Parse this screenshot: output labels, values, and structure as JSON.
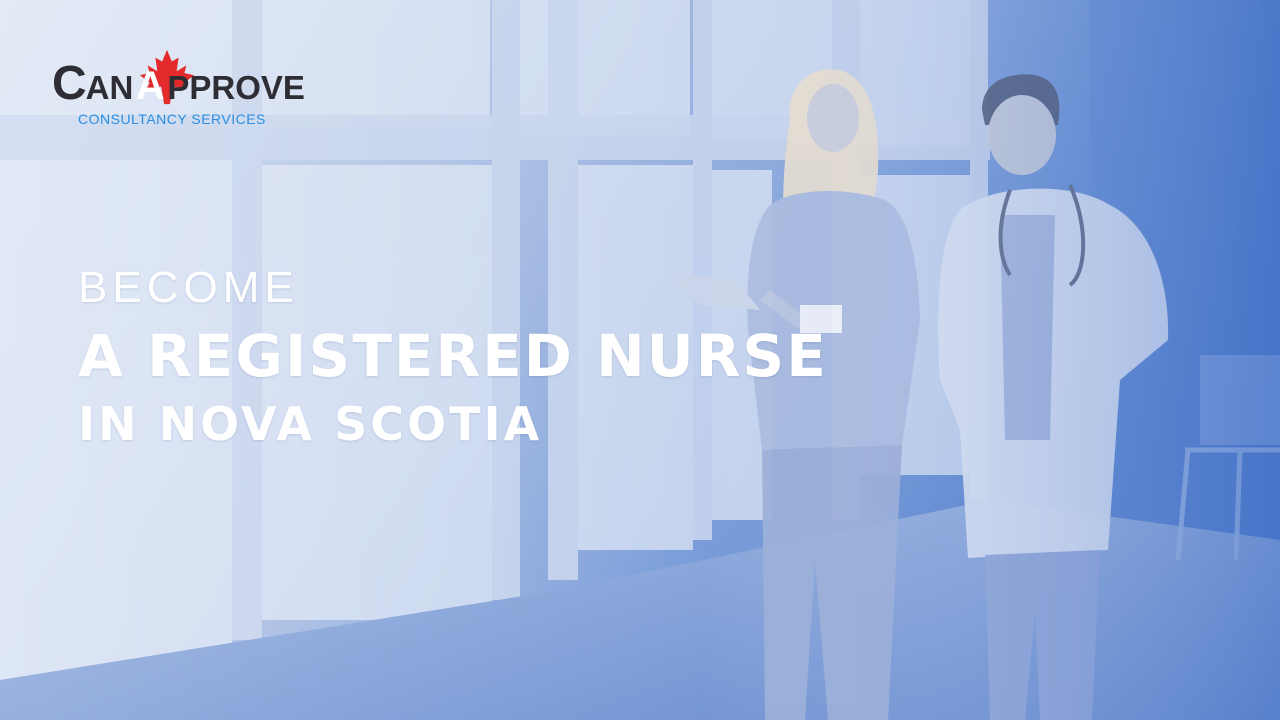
{
  "logo": {
    "can": "C",
    "an": "AN",
    "a": "A",
    "pprove": "PPROVE",
    "subtitle": "CONSULTANCY SERVICES",
    "leaf_color": "#e32b2b",
    "wordmark_color": "#2d2d33",
    "subtitle_color": "#2a8fe0"
  },
  "headline": {
    "line1": "BECOME",
    "line2": "A REGISTERED NURSE",
    "line3": "IN NOVA SCOTIA"
  },
  "theme": {
    "overlay_light": "#c9d6ee",
    "overlay_dark": "#3b6bc4"
  },
  "icons": [
    "maple-leaf-icon"
  ]
}
